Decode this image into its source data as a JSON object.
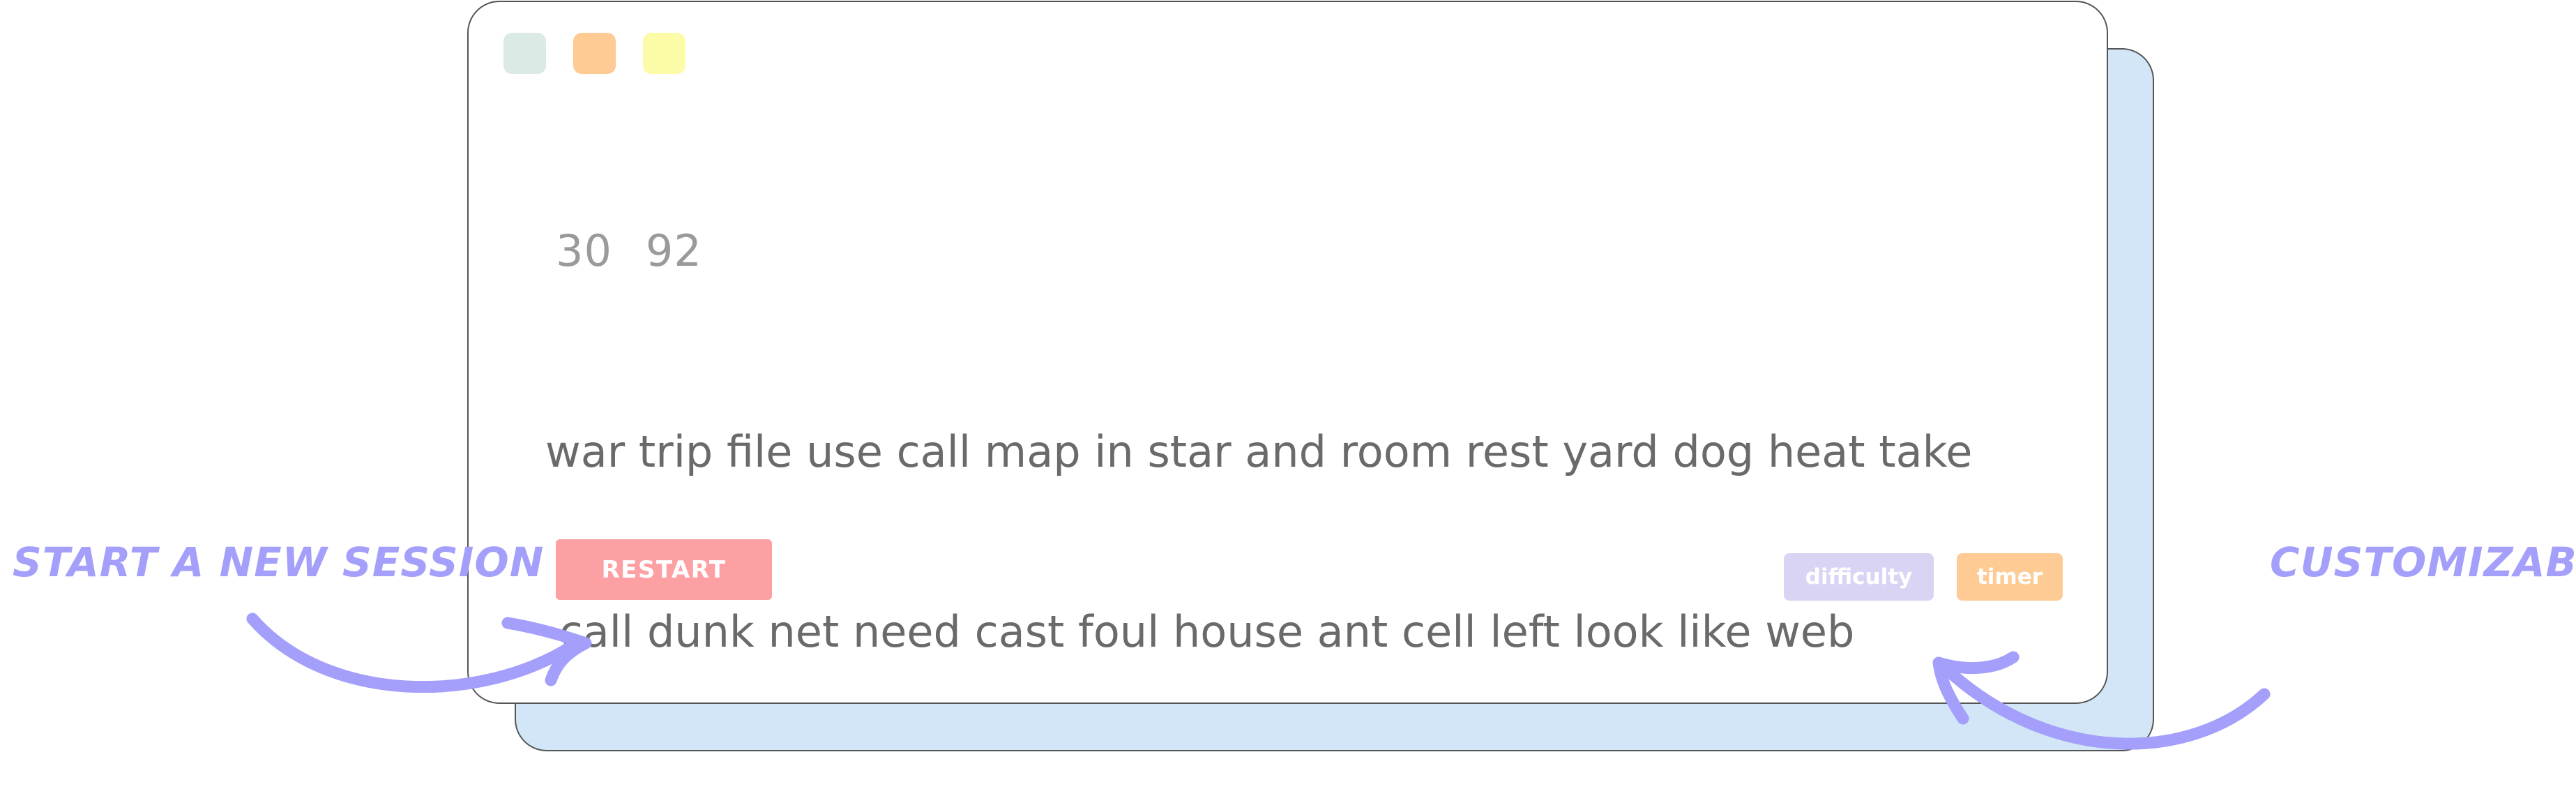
{
  "colors": {
    "dot_1": "#dceae6",
    "dot_2": "#fecb94",
    "dot_3": "#fcfca8",
    "restart_bg": "#fda0a3",
    "difficulty_bg": "#d9d4f4",
    "timer_bg": "#fecb94",
    "annotation": "#a39ffa",
    "shadow_card": "#d2e6f7"
  },
  "stats": {
    "time": "30",
    "wpm": "92"
  },
  "words": {
    "line_1": "war trip file use call map in star and room rest yard dog heat take",
    "line_2": " call dunk net need cast foul house ant cell left look like web"
  },
  "buttons": {
    "restart": "RESTART",
    "difficulty": "difficulty",
    "timer": "timer"
  },
  "annotations": {
    "left": "START A NEW SESSION",
    "right": "CUSTOMIZABLE"
  },
  "icons": {
    "left_arrow": "curved-arrow-icon",
    "right_arrow": "curved-arrow-icon"
  }
}
